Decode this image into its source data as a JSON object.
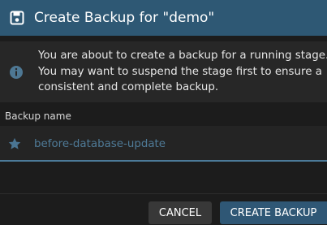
{
  "dialog": {
    "title": "Create Backup for \"demo\"",
    "title_icon": "save-icon",
    "colors": {
      "title_bar": "#2e5874",
      "accent": "#4c7a99",
      "background": "#1c1c1c"
    }
  },
  "info": {
    "icon": "info-icon",
    "lines": [
      "You are about to create a backup for a running stage.",
      "You may want to suspend the stage first to ensure a",
      "consistent and complete backup."
    ]
  },
  "form": {
    "backup_name_label": "Backup name",
    "backup_name_value": "before-database-update",
    "field_icon": "star-icon"
  },
  "actions": {
    "cancel_label": "Cancel",
    "create_label": "Create Backup"
  }
}
